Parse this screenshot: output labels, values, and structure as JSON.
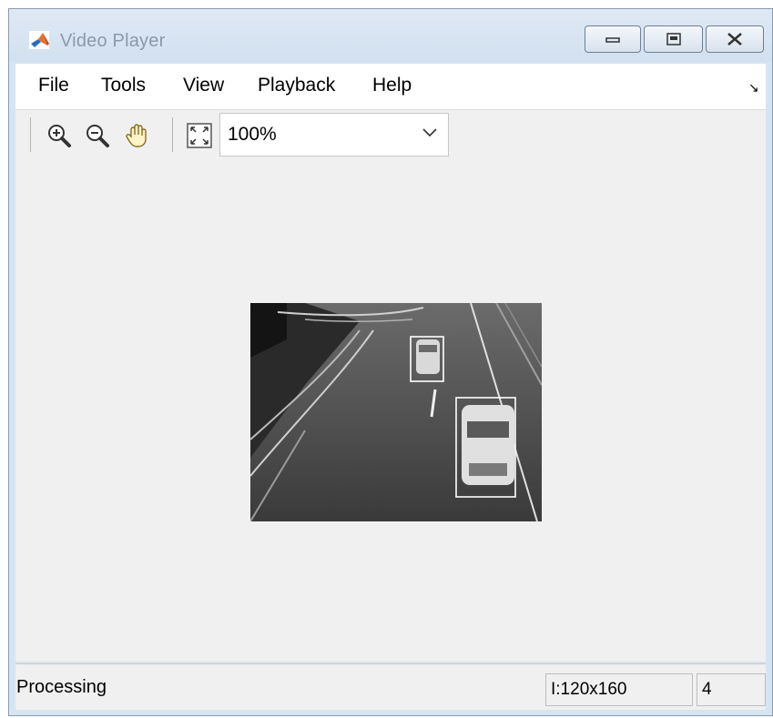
{
  "window": {
    "title": "Video Player",
    "app_icon": "matlab-logo-icon",
    "controls": [
      "minimize-icon",
      "maximize-icon",
      "close-icon"
    ]
  },
  "menu": {
    "items": [
      "File",
      "Tools",
      "View",
      "Playback",
      "Help"
    ],
    "dock_arrow": "↘"
  },
  "toolbar": {
    "icons": [
      "zoom-in-icon",
      "zoom-out-icon",
      "pan-hand-icon",
      "fit-to-window-icon"
    ],
    "zoom": "100%"
  },
  "viewer": {
    "content": "grayscale highway video frame with two detected cars in white bounding boxes",
    "detections": 2
  },
  "status": {
    "text": "Processing",
    "dimensions": "I:120x160",
    "frame": "4"
  }
}
